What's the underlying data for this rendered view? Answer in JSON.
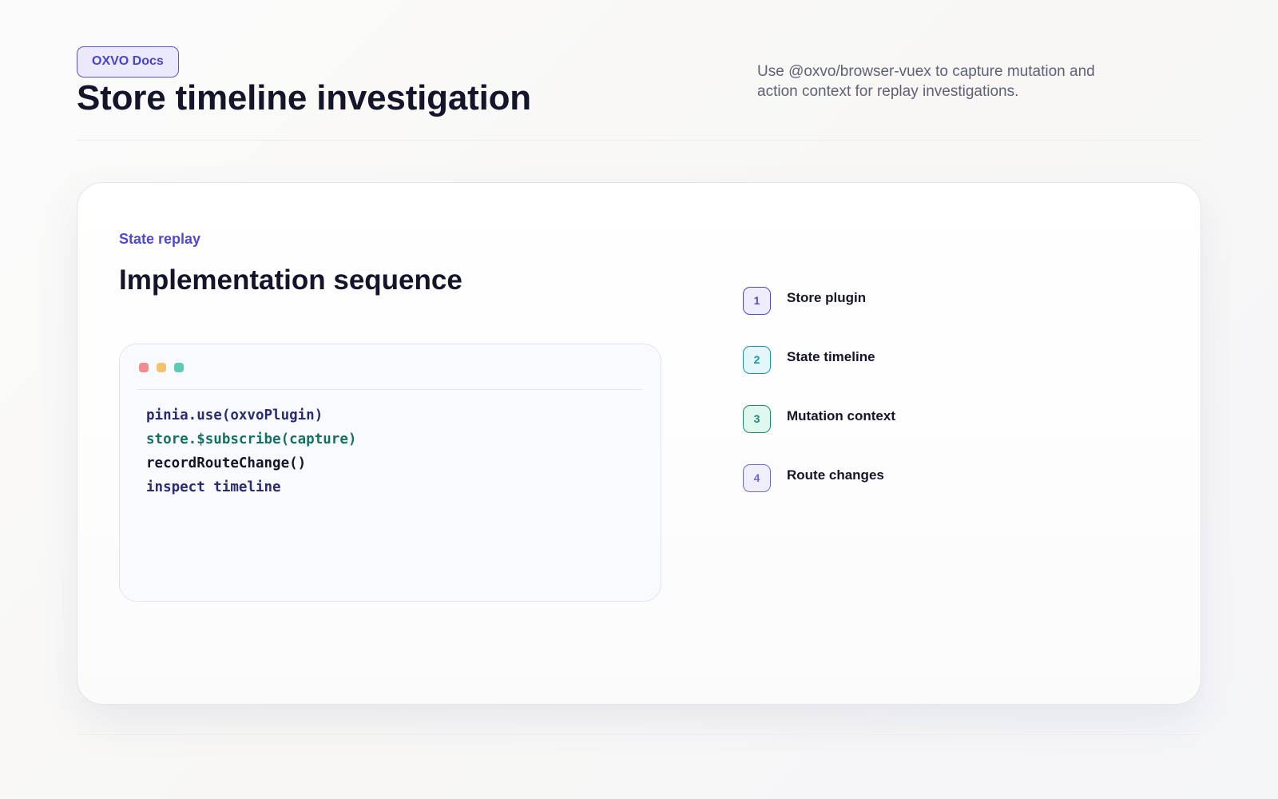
{
  "header": {
    "badge": "OXVO Docs",
    "title": "Store timeline investigation",
    "description": "Use @oxvo/browser-vuex to capture mutation and action context for replay investigations."
  },
  "card": {
    "eyebrow": "State replay",
    "title": "Implementation sequence",
    "code": {
      "lines": [
        {
          "text": "pinia.use(oxvoPlugin)",
          "color": "#2b2a72"
        },
        {
          "text": "store.$subscribe(capture)",
          "color": "#137160"
        },
        {
          "text": "recordRouteChange()",
          "color": "#14142b"
        },
        {
          "text": "inspect timeline",
          "color": "#2b2a72"
        }
      ]
    },
    "steps": [
      {
        "number": "1",
        "label": "Store plugin",
        "color": "#5148d6",
        "bg": "#eeedfd"
      },
      {
        "number": "2",
        "label": "State timeline",
        "color": "#1b93a8",
        "bg": "#e3f7fa"
      },
      {
        "number": "3",
        "label": "Mutation context",
        "color": "#1a8a6e",
        "bg": "#e0f7ef"
      },
      {
        "number": "4",
        "label": "Route changes",
        "color": "#6d6ad8",
        "bg": "#eeeefd"
      }
    ]
  }
}
